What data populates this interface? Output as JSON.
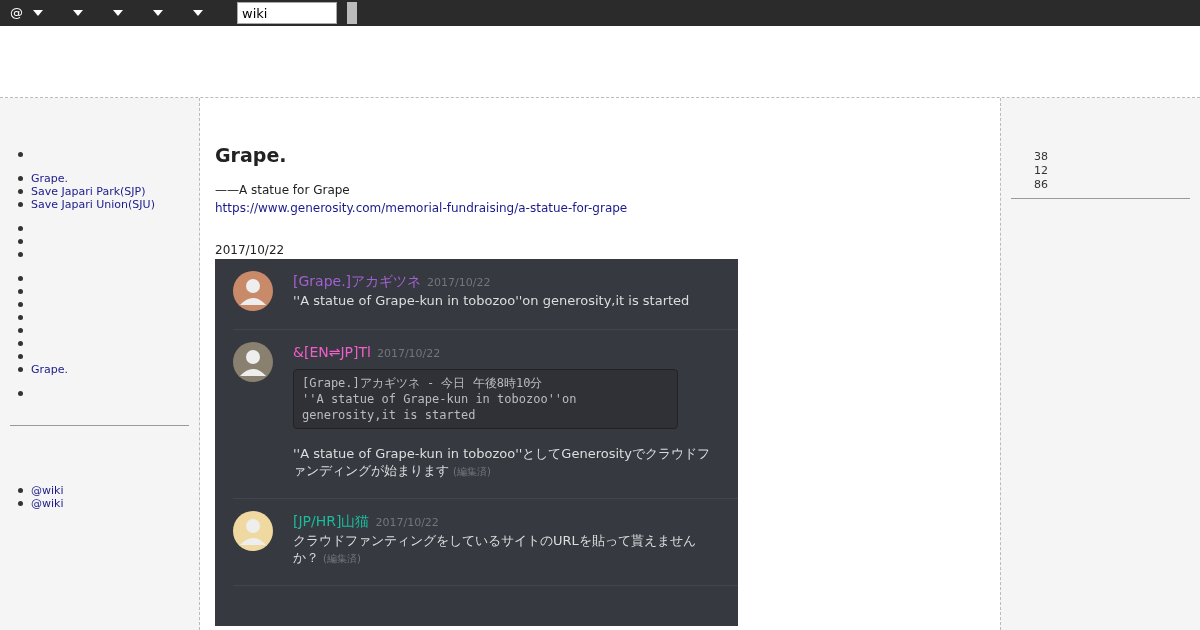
{
  "topbar": {
    "logo": "@",
    "search": {
      "value": "wiki"
    }
  },
  "left_sidebar": {
    "groups": [
      {
        "items": [
          {
            "kind": "bullet"
          }
        ]
      },
      {
        "items": [
          {
            "kind": "link",
            "text": "Grape."
          },
          {
            "kind": "link",
            "text": "Save Japari Park(SJP)"
          },
          {
            "kind": "link",
            "text": "Save Japari Union(SJU)"
          }
        ]
      },
      {
        "items": [
          {
            "kind": "bullet"
          },
          {
            "kind": "bullet"
          },
          {
            "kind": "bullet"
          }
        ]
      },
      {
        "items": [
          {
            "kind": "bullet"
          },
          {
            "kind": "bullet"
          },
          {
            "kind": "bullet"
          },
          {
            "kind": "bullet"
          },
          {
            "kind": "bullet"
          },
          {
            "kind": "bullet"
          },
          {
            "kind": "bullet"
          },
          {
            "kind": "link",
            "text": "Grape."
          }
        ]
      },
      {
        "items": [
          {
            "kind": "bullet"
          }
        ]
      }
    ],
    "footer_items": [
      {
        "kind": "link",
        "text": "@wiki"
      },
      {
        "kind": "link",
        "text": "@wiki"
      }
    ]
  },
  "article": {
    "title": "Grape.",
    "subtitle": "——A statue for Grape",
    "link": "https://www.generosity.com/memorial-fundraising/a-statue-for-grape",
    "date": "2017/10/22",
    "chat": [
      {
        "author": "[Grape.]アカギツネ",
        "color": "#a061d1",
        "time": "2017/10/22",
        "text": "''A statue of Grape-kun in tobozoo''on generosity,it is started"
      },
      {
        "author": "&[EN⇌JP]Tl",
        "color": "#f25ecb",
        "time": "2017/10/22",
        "quote": [
          "[Grape.]アカギツネ - 今日 午後8時10分",
          "''A statue of Grape-kun in tobozoo''on",
          "generosity,it is started"
        ],
        "text": "''A statue of Grape-kun in tobozoo''としてGenerosityでクラウドファンディングが始まります",
        "edited": "(編集済)"
      },
      {
        "author": "[JP/HR]山猫",
        "color": "#1abc9c",
        "time": "2017/10/22",
        "text": "クラウドファンティングをしているサイトのURLを貼って貰えませんか？",
        "edited": "(編集済)"
      }
    ]
  },
  "right_sidebar": {
    "counts": [
      "38",
      "12",
      "86"
    ]
  }
}
